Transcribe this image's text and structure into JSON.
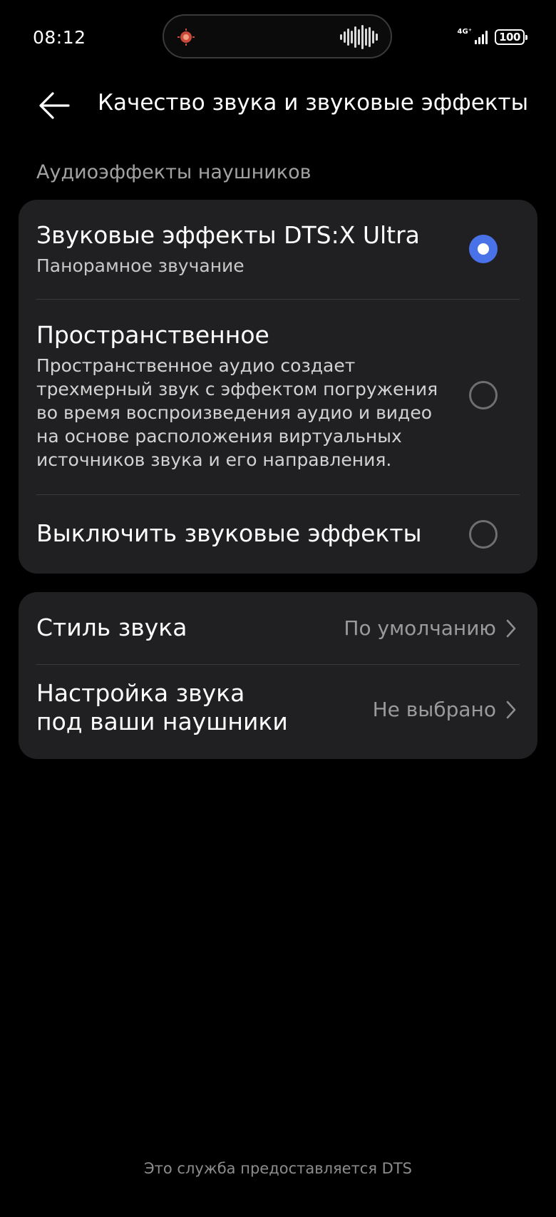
{
  "status_bar": {
    "time": "08:12",
    "network": "4G⁺",
    "battery": "100",
    "icons": [
      "app-activity-icon",
      "audio-wave-icon",
      "signal-icon",
      "battery-icon"
    ]
  },
  "header": {
    "back_icon": "arrow-left-icon",
    "title": "Качество звука и звуковые эффекты"
  },
  "section": {
    "label": "Аудиоэффекты наушников"
  },
  "effects": [
    {
      "title": "Звуковые эффекты DTS:X Ultra",
      "subtitle": "Панорамное звучание",
      "selected": true
    },
    {
      "title": "Пространственное",
      "subtitle_lines": [
        "Пространственное аудио создает",
        "трехмерный звук с эффектом погружения",
        "во время воспроизведения аудио и видео",
        "на основе расположения виртуальных",
        "источников звука и его направления."
      ],
      "selected": false
    },
    {
      "title": "Выключить звуковые эффекты",
      "selected": false
    }
  ],
  "settings": [
    {
      "title": "Стиль звука",
      "value": "По умолчанию"
    },
    {
      "title_lines": [
        "Настройка звука",
        "под ваши наушники"
      ],
      "value": "Не выбрано"
    }
  ],
  "footer": "Это служба предоставляется DTS",
  "colors": {
    "background": "#000000",
    "card": "#202022",
    "accent": "#4a72e8",
    "secondary_text": "#a2a2a2"
  }
}
